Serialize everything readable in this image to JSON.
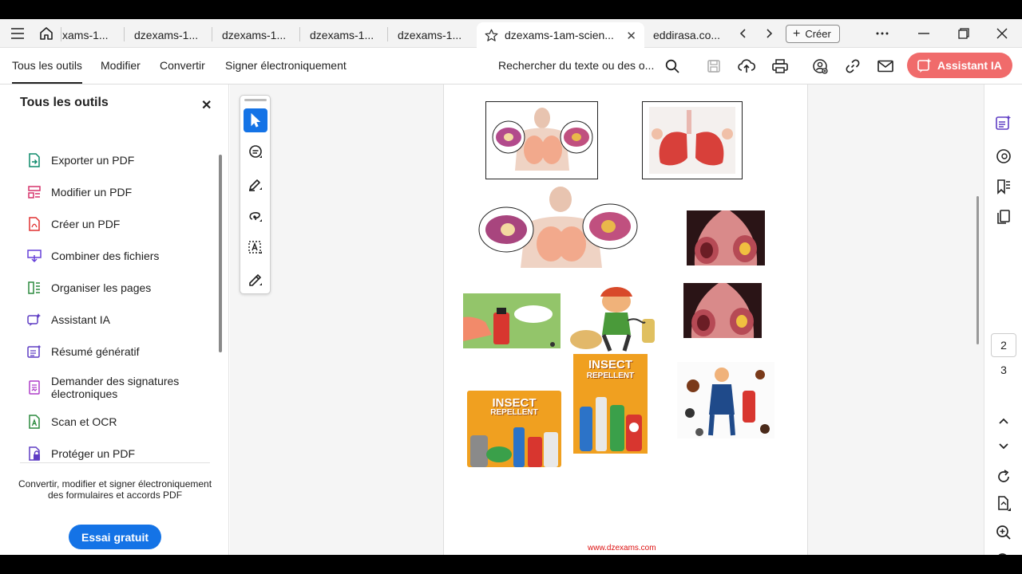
{
  "tabs": [
    {
      "label": "xams-1..."
    },
    {
      "label": "dzexams-1..."
    },
    {
      "label": "dzexams-1..."
    },
    {
      "label": "dzexams-1..."
    },
    {
      "label": "dzexams-1..."
    },
    {
      "label": "dzexams-1am-scien..."
    },
    {
      "label": "eddirasa.co..."
    }
  ],
  "create_label": "Créer",
  "menu": {
    "all_tools": "Tous les outils",
    "edit": "Modifier",
    "convert": "Convertir",
    "sign": "Signer électroniquement"
  },
  "search_placeholder": "Rechercher du texte ou des o...",
  "assistant_label": "Assistant IA",
  "left_panel": {
    "title": "Tous les outils",
    "items": [
      {
        "label": "Exporter un PDF",
        "icon": "export-pdf-icon",
        "color": "#0d8a6a"
      },
      {
        "label": "Modifier un PDF",
        "icon": "edit-pdf-icon",
        "color": "#d6336c"
      },
      {
        "label": "Créer un PDF",
        "icon": "create-pdf-icon",
        "color": "#e03131"
      },
      {
        "label": "Combiner des fichiers",
        "icon": "combine-files-icon",
        "color": "#6741d9"
      },
      {
        "label": "Organiser les pages",
        "icon": "organize-pages-icon",
        "color": "#2b8a3e"
      },
      {
        "label": "Assistant IA",
        "icon": "ai-assistant-icon",
        "color": "#5f3dc4"
      },
      {
        "label": "Résumé génératif",
        "icon": "generative-summary-icon",
        "color": "#5f3dc4"
      },
      {
        "label": "Demander des signatures électroniques",
        "icon": "request-signatures-icon",
        "color": "#ae3ec9"
      },
      {
        "label": "Scan et OCR",
        "icon": "scan-ocr-icon",
        "color": "#2b8a3e"
      },
      {
        "label": "Protéger un PDF",
        "icon": "protect-pdf-icon",
        "color": "#5f3dc4"
      }
    ],
    "promo": "Convertir, modifier et signer électroniquement des formulaires et accords PDF",
    "trial_button": "Essai gratuit"
  },
  "document": {
    "footer_link": "www.dzexams.com",
    "image_banners": [
      "INSECT",
      "REPELLENT"
    ]
  },
  "page_nav": {
    "current": "2",
    "next": "3"
  },
  "colors": {
    "accent": "#1473e6",
    "assistant": "#f06b6b",
    "footer": "#dd1111"
  }
}
